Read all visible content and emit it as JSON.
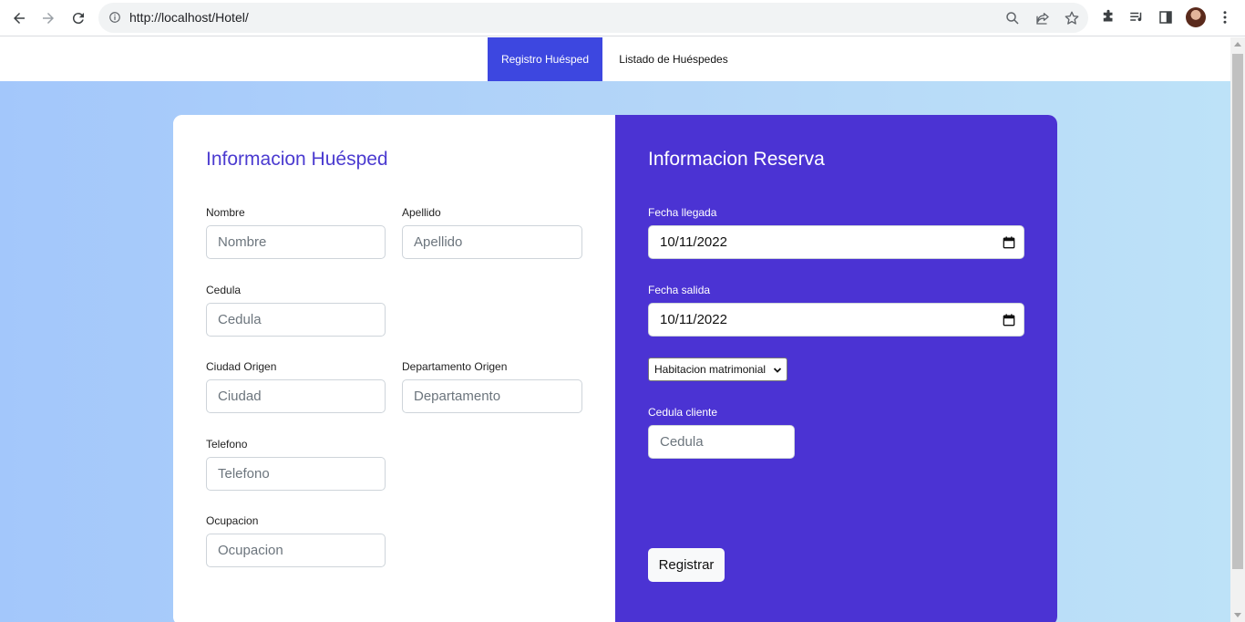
{
  "browser": {
    "url": "http://localhost/Hotel/"
  },
  "nav": {
    "tabs": [
      {
        "label": "Registro Huésped",
        "active": true
      },
      {
        "label": "Listado de Huéspedes",
        "active": false
      }
    ]
  },
  "guest": {
    "title": "Informacion Huésped",
    "fields": {
      "nombre": {
        "label": "Nombre",
        "placeholder": "Nombre",
        "value": ""
      },
      "apellido": {
        "label": "Apellido",
        "placeholder": "Apellido",
        "value": ""
      },
      "cedula": {
        "label": "Cedula",
        "placeholder": "Cedula",
        "value": ""
      },
      "ciudad": {
        "label": "Ciudad Origen",
        "placeholder": "Ciudad",
        "value": ""
      },
      "departamento": {
        "label": "Departamento Origen",
        "placeholder": "Departamento",
        "value": ""
      },
      "telefono": {
        "label": "Telefono",
        "placeholder": "Telefono",
        "value": ""
      },
      "ocupacion": {
        "label": "Ocupacion",
        "placeholder": "Ocupacion",
        "value": ""
      }
    }
  },
  "reservation": {
    "title": "Informacion Reserva",
    "fecha_llegada": {
      "label": "Fecha llegada",
      "value": "10/11/2022"
    },
    "fecha_salida": {
      "label": "Fecha salida",
      "value": "10/11/2022"
    },
    "room_type": {
      "selected": "Habitacion matrimonial"
    },
    "cedula_cliente": {
      "label": "Cedula cliente",
      "placeholder": "Cedula",
      "value": ""
    },
    "submit_label": "Registrar"
  },
  "colors": {
    "nav_active": "#3d47e0",
    "reservation_panel": "#4b33d3",
    "guest_title": "#4b3bd0"
  }
}
